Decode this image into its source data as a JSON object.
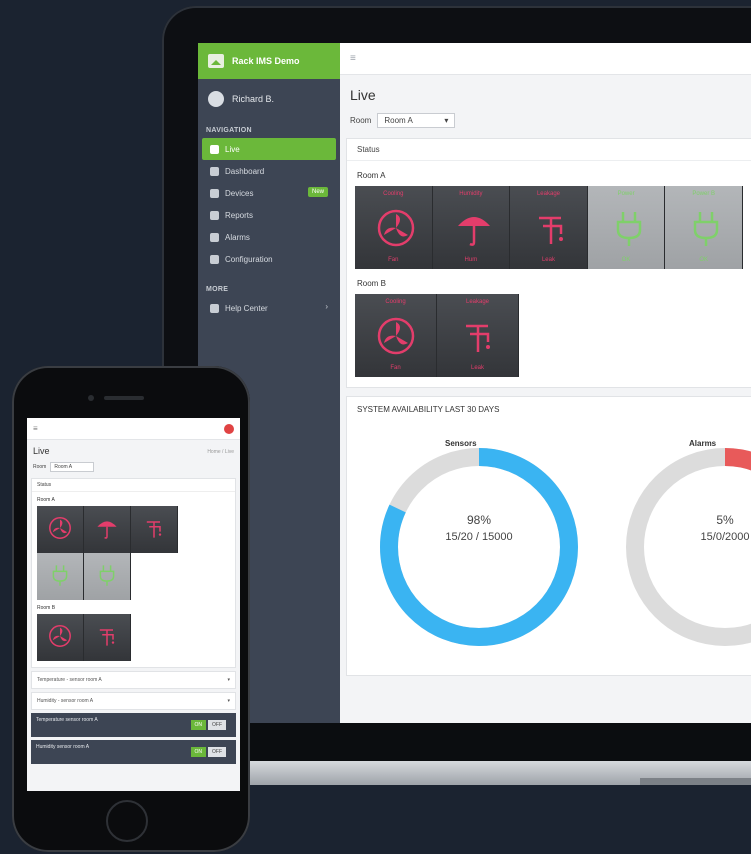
{
  "laptop": {
    "brand": "Rack IMS Demo",
    "user": "Richard B.",
    "sidebar_section_1": "NAVIGATION",
    "sidebar_items": [
      {
        "label": "Live",
        "active": true
      },
      {
        "label": "Dashboard",
        "active": false
      },
      {
        "label": "Devices",
        "active": false,
        "badge": "New"
      },
      {
        "label": "Reports",
        "active": false
      },
      {
        "label": "Alarms",
        "active": false
      },
      {
        "label": "Configuration",
        "active": false
      }
    ],
    "sidebar_section_2": "MORE",
    "sidebar_more_item": "Help Center",
    "page_title": "Live",
    "filter_label": "Room",
    "filter_value": "Room A",
    "status_card_header": "Status",
    "group_1_title": "Room A",
    "group_2_title": "Room B",
    "tiles_group_1": [
      {
        "label": "Cooling",
        "caption": "Fan",
        "state": "alarm",
        "icon": "fan-icon"
      },
      {
        "label": "Humidity",
        "caption": "Hum",
        "state": "alarm",
        "icon": "umbrella-icon"
      },
      {
        "label": "Leakage",
        "caption": "Leak",
        "state": "alarm",
        "icon": "faucet-icon"
      },
      {
        "label": "Power",
        "caption": "OK",
        "state": "ok",
        "icon": "plug-icon"
      },
      {
        "label": "Power B",
        "caption": "OK",
        "state": "ok",
        "icon": "plug-icon"
      }
    ],
    "tiles_group_2": [
      {
        "label": "Cooling",
        "caption": "Fan",
        "state": "alarm",
        "icon": "fan-icon"
      },
      {
        "label": "Leakage",
        "caption": "Leak",
        "state": "alarm",
        "icon": "faucet-icon"
      }
    ],
    "kpi_header": "SYSTEM AVAILABILITY LAST 30 DAYS",
    "donuts": [
      {
        "label": "Sensors",
        "value": "98%",
        "sub": "15/20 / 15000",
        "fraction": 0.82,
        "color": "#3ab4f2"
      },
      {
        "label": "Alarms",
        "value": "5%",
        "sub": "15/0/2000",
        "fraction": 0.12,
        "color": "#e85a5a"
      }
    ]
  },
  "phone": {
    "title": "Live",
    "breadcrumb": "Home / Live",
    "filter_label": "Room",
    "filter_value": "Room A",
    "status_header": "Status",
    "group_1_title": "Room A",
    "group_2_title": "Room B",
    "list_rows": [
      "Temperature - sensor room A",
      "Humidity - sensor room A"
    ],
    "dark_rows": [
      "Temperature sensor room A",
      "Humidity sensor room A"
    ],
    "toggle_on": "ON",
    "toggle_off": "OFF"
  }
}
